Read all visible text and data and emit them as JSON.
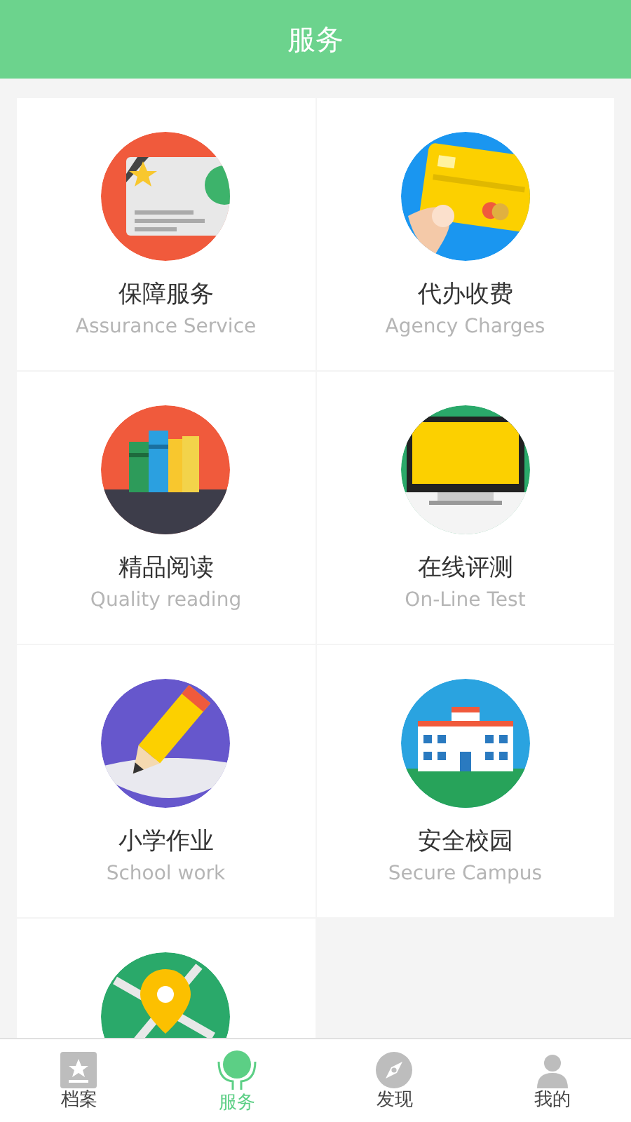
{
  "header": {
    "title": "服务"
  },
  "services": [
    {
      "kind": "certificate",
      "title": "保障服务",
      "subtitle": "Assurance Service"
    },
    {
      "kind": "card",
      "title": "代办收费",
      "subtitle": "Agency Charges"
    },
    {
      "kind": "books",
      "title": "精品阅读",
      "subtitle": "Quality reading"
    },
    {
      "kind": "monitor",
      "title": "在线评测",
      "subtitle": "On-Line Test"
    },
    {
      "kind": "pencil",
      "title": "小学作业",
      "subtitle": "School work"
    },
    {
      "kind": "school",
      "title": "安全校园",
      "subtitle": "Secure Campus"
    },
    {
      "kind": "map"
    }
  ],
  "tabs": [
    {
      "kind": "archive",
      "label": "档案",
      "selected": false
    },
    {
      "kind": "service",
      "label": "服务",
      "selected": true
    },
    {
      "kind": "discover",
      "label": "发现",
      "selected": false
    },
    {
      "kind": "me",
      "label": "我的",
      "selected": false
    }
  ]
}
